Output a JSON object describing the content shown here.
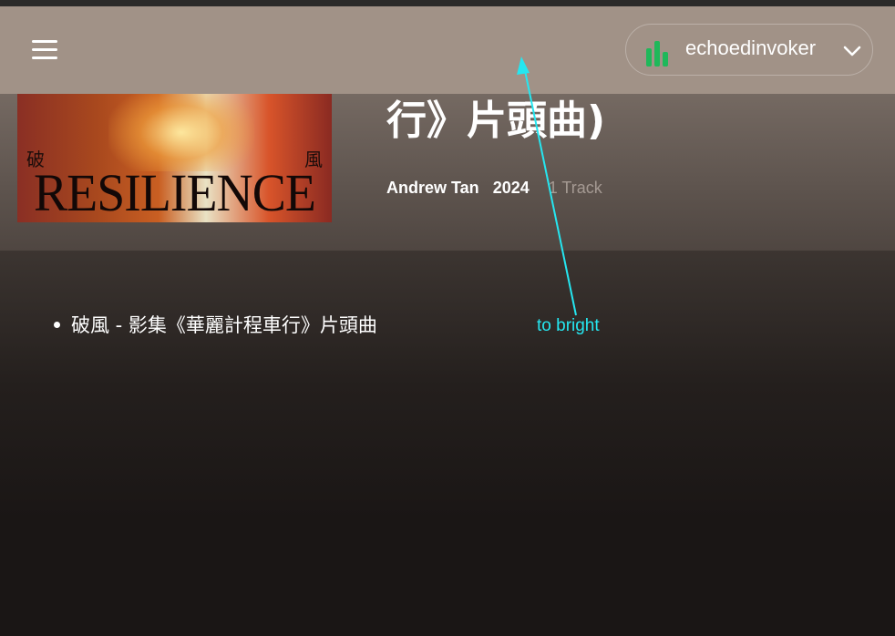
{
  "header": {
    "user": {
      "name": "echoedinvoker"
    }
  },
  "album": {
    "title_visible": "行》片頭曲)",
    "artist": "Andrew Tan",
    "year": "2024",
    "track_count": "1 Track",
    "cover": {
      "char_left": "破",
      "char_right": "風",
      "word": "RESILIENCE"
    }
  },
  "tracks": [
    {
      "title": "破風 - 影集《華麗計程車行》片頭曲"
    }
  ],
  "annotation": {
    "text": "to bright",
    "color": "#25e6f0"
  },
  "colors": {
    "header": "#a19287",
    "background": "#1a1615",
    "logo_green": "#1fb85a"
  }
}
